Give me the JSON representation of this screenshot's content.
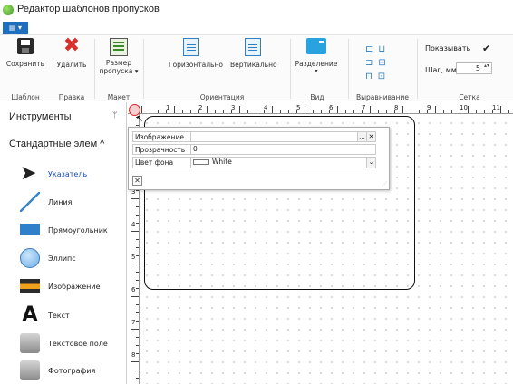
{
  "window": {
    "title": "Редактор шаблонов пропусков"
  },
  "menu": {
    "button_label": "▤ ▾"
  },
  "ribbon": {
    "buttons": {
      "save": "Сохранить",
      "delete": "Удалить",
      "size_line1": "Размер",
      "size_line2": "пропуска ▾",
      "horizontal": "Горизонтально",
      "vertical": "Вертикально",
      "split": "Разделение",
      "split_arrow": "▾"
    },
    "groups": {
      "template": "Шаблон",
      "edit": "Правка",
      "layout": "Макет",
      "orientation": "Ориентация",
      "view": "Вид",
      "align": "Выравнивание",
      "grid": "Сетка"
    },
    "grid": {
      "show_label": "Показывать",
      "show_checked": "✔",
      "step_label": "Шаг, мм",
      "step_value": "5",
      "spin": "▴▾"
    }
  },
  "left_panel": {
    "header": "Инструменты",
    "pin": "ᛘ",
    "section": "Стандартные элем ^",
    "tools": [
      {
        "label": "Указатель",
        "icon": "arrow-pointer-icon"
      },
      {
        "label": "Линия",
        "icon": "line-icon"
      },
      {
        "label": "Прямоугольник",
        "icon": "rectangle-icon"
      },
      {
        "label": "Эллипс",
        "icon": "ellipse-icon"
      },
      {
        "label": "Изображение",
        "icon": "image-icon"
      },
      {
        "label": "Текст",
        "icon": "text-icon",
        "glyph": "A"
      },
      {
        "label": "Текстовое поле",
        "icon": "textbox-icon"
      },
      {
        "label": "Фотография",
        "icon": "photo-icon"
      }
    ]
  },
  "rulers": {
    "h": [
      "1",
      "2",
      "3",
      "4",
      "5",
      "6",
      "7",
      "8",
      "9",
      "10",
      "11"
    ],
    "v": [
      "3",
      "4",
      "5",
      "6",
      "7",
      "8"
    ]
  },
  "properties": {
    "rows": [
      {
        "label": "Изображение",
        "value": "",
        "buttons": [
          "...",
          "✕"
        ]
      },
      {
        "label": "Прозрачность",
        "value": "0"
      },
      {
        "label": "Цвет фона",
        "value": "White",
        "dropdown": "⌄"
      }
    ],
    "close": "✕",
    "grip": "⋰"
  },
  "colors": {
    "accent": "#1e6fbf",
    "marker_red": "#dd2222",
    "link": "#1e4fb0"
  }
}
